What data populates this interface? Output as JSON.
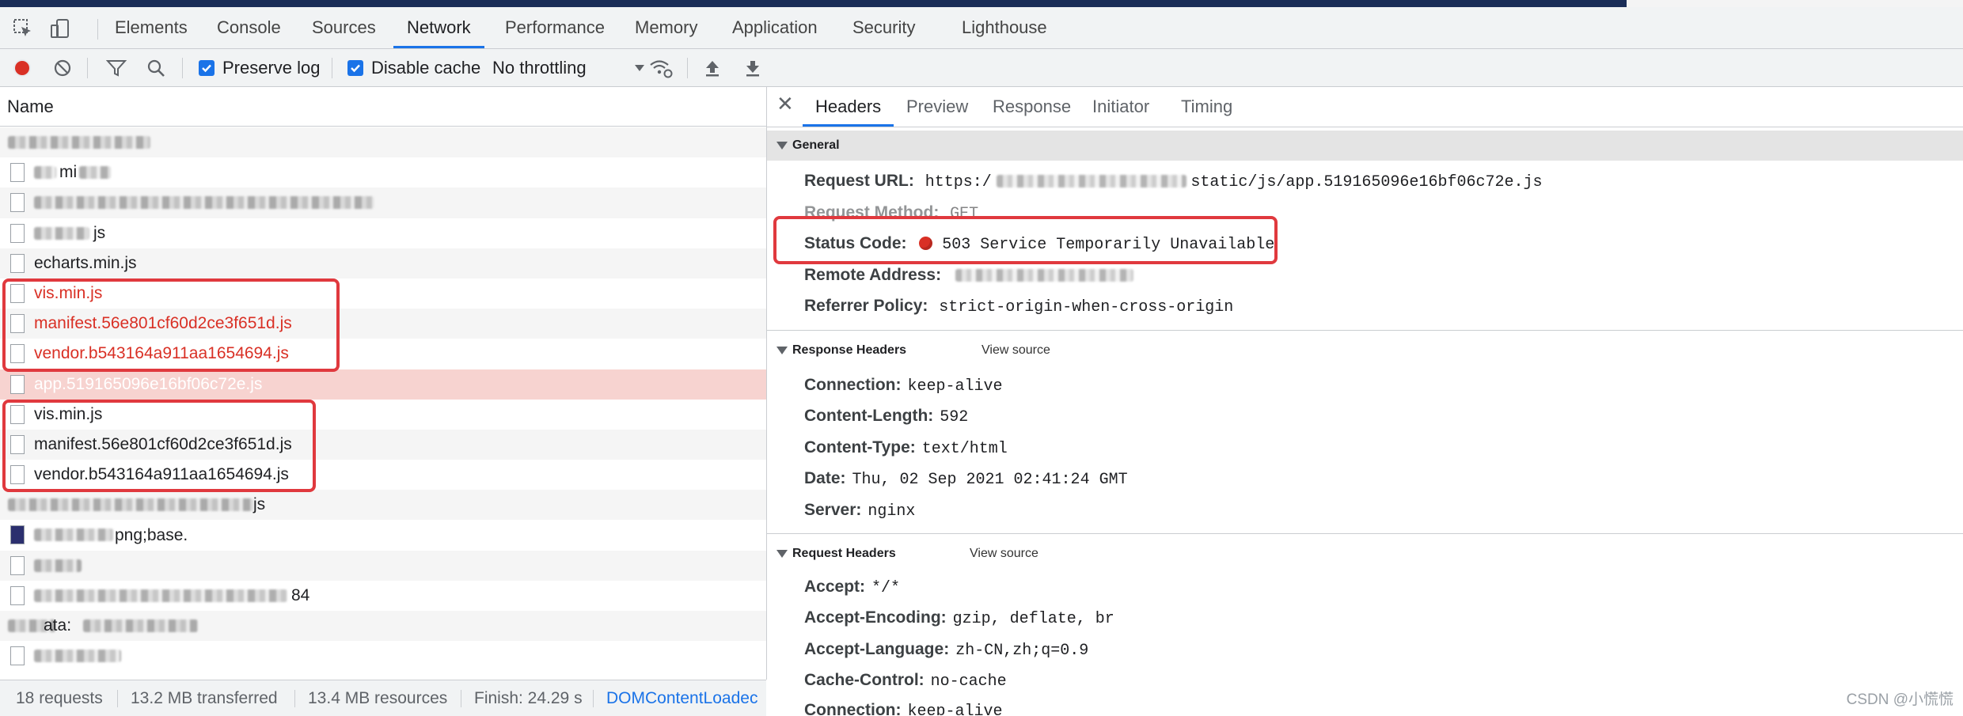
{
  "main_tabs": [
    "Elements",
    "Console",
    "Sources",
    "Network",
    "Performance",
    "Memory",
    "Application",
    "Security",
    "Lighthouse"
  ],
  "toolbar": {
    "preserve_log": "Preserve log",
    "disable_cache": "Disable cache",
    "throttling": "No throttling"
  },
  "request_list": {
    "header": "Name",
    "rows": [
      {
        "name": ""
      },
      {
        "name": "mi"
      },
      {
        "name": ""
      },
      {
        "name": "js"
      },
      {
        "name": "echarts.min.js"
      },
      {
        "name": "vis.min.js",
        "status": "error"
      },
      {
        "name": "manifest.56e801cf60d2ce3f651d.js",
        "status": "error"
      },
      {
        "name": "vendor.b543164a911aa1654694.js",
        "status": "error"
      },
      {
        "name": "app.519165096e16bf06c72e.js",
        "status": "selected"
      },
      {
        "name": "vis.min.js"
      },
      {
        "name": "manifest.56e801cf60d2ce3f651d.js"
      },
      {
        "name": "vendor.b543164a911aa1654694.js"
      },
      {
        "name": "js"
      },
      {
        "name": "png;base."
      },
      {
        "name": ""
      },
      {
        "name": "84"
      },
      {
        "name": "ata:"
      },
      {
        "name": ""
      }
    ]
  },
  "status_bar": {
    "requests": "18 requests",
    "transferred": "13.2 MB transferred",
    "resources": "13.4 MB resources",
    "finish": "Finish: 24.29 s",
    "domcontent": "DOMContentLoadec"
  },
  "detail_tabs": [
    "Headers",
    "Preview",
    "Response",
    "Initiator",
    "Timing"
  ],
  "general": {
    "title": "General",
    "request_url_key": "Request URL:",
    "request_url_prefix": "https:/",
    "request_url_suffix": "static/js/app.519165096e16bf06c72e.js",
    "request_method_key": "Request Method:",
    "request_method": "GET",
    "status_code_key": "Status Code:",
    "status_code": "503 Service Temporarily Unavailable",
    "remote_address_key": "Remote Address:",
    "referrer_policy_key": "Referrer Policy:",
    "referrer_policy": "strict-origin-when-cross-origin"
  },
  "response_headers": {
    "title": "Response Headers",
    "view_source": "View source",
    "items": [
      {
        "key": "Connection:",
        "value": "keep-alive"
      },
      {
        "key": "Content-Length:",
        "value": "592"
      },
      {
        "key": "Content-Type:",
        "value": "text/html"
      },
      {
        "key": "Date:",
        "value": "Thu, 02 Sep 2021 02:41:24 GMT"
      },
      {
        "key": "Server:",
        "value": "nginx"
      }
    ]
  },
  "request_headers": {
    "title": "Request Headers",
    "view_source": "View source",
    "items": [
      {
        "key": "Accept:",
        "value": "*/*"
      },
      {
        "key": "Accept-Encoding:",
        "value": "gzip, deflate, br"
      },
      {
        "key": "Accept-Language:",
        "value": "zh-CN,zh;q=0.9"
      },
      {
        "key": "Cache-Control:",
        "value": "no-cache"
      },
      {
        "key": "Connection:",
        "value": "keep-alive"
      }
    ]
  },
  "watermark": "CSDN @小慌慌",
  "colors": {
    "accent": "#1a73e8",
    "error": "#d93025",
    "highlight": "#e0393e",
    "selected_row": "#f7d3d0"
  }
}
